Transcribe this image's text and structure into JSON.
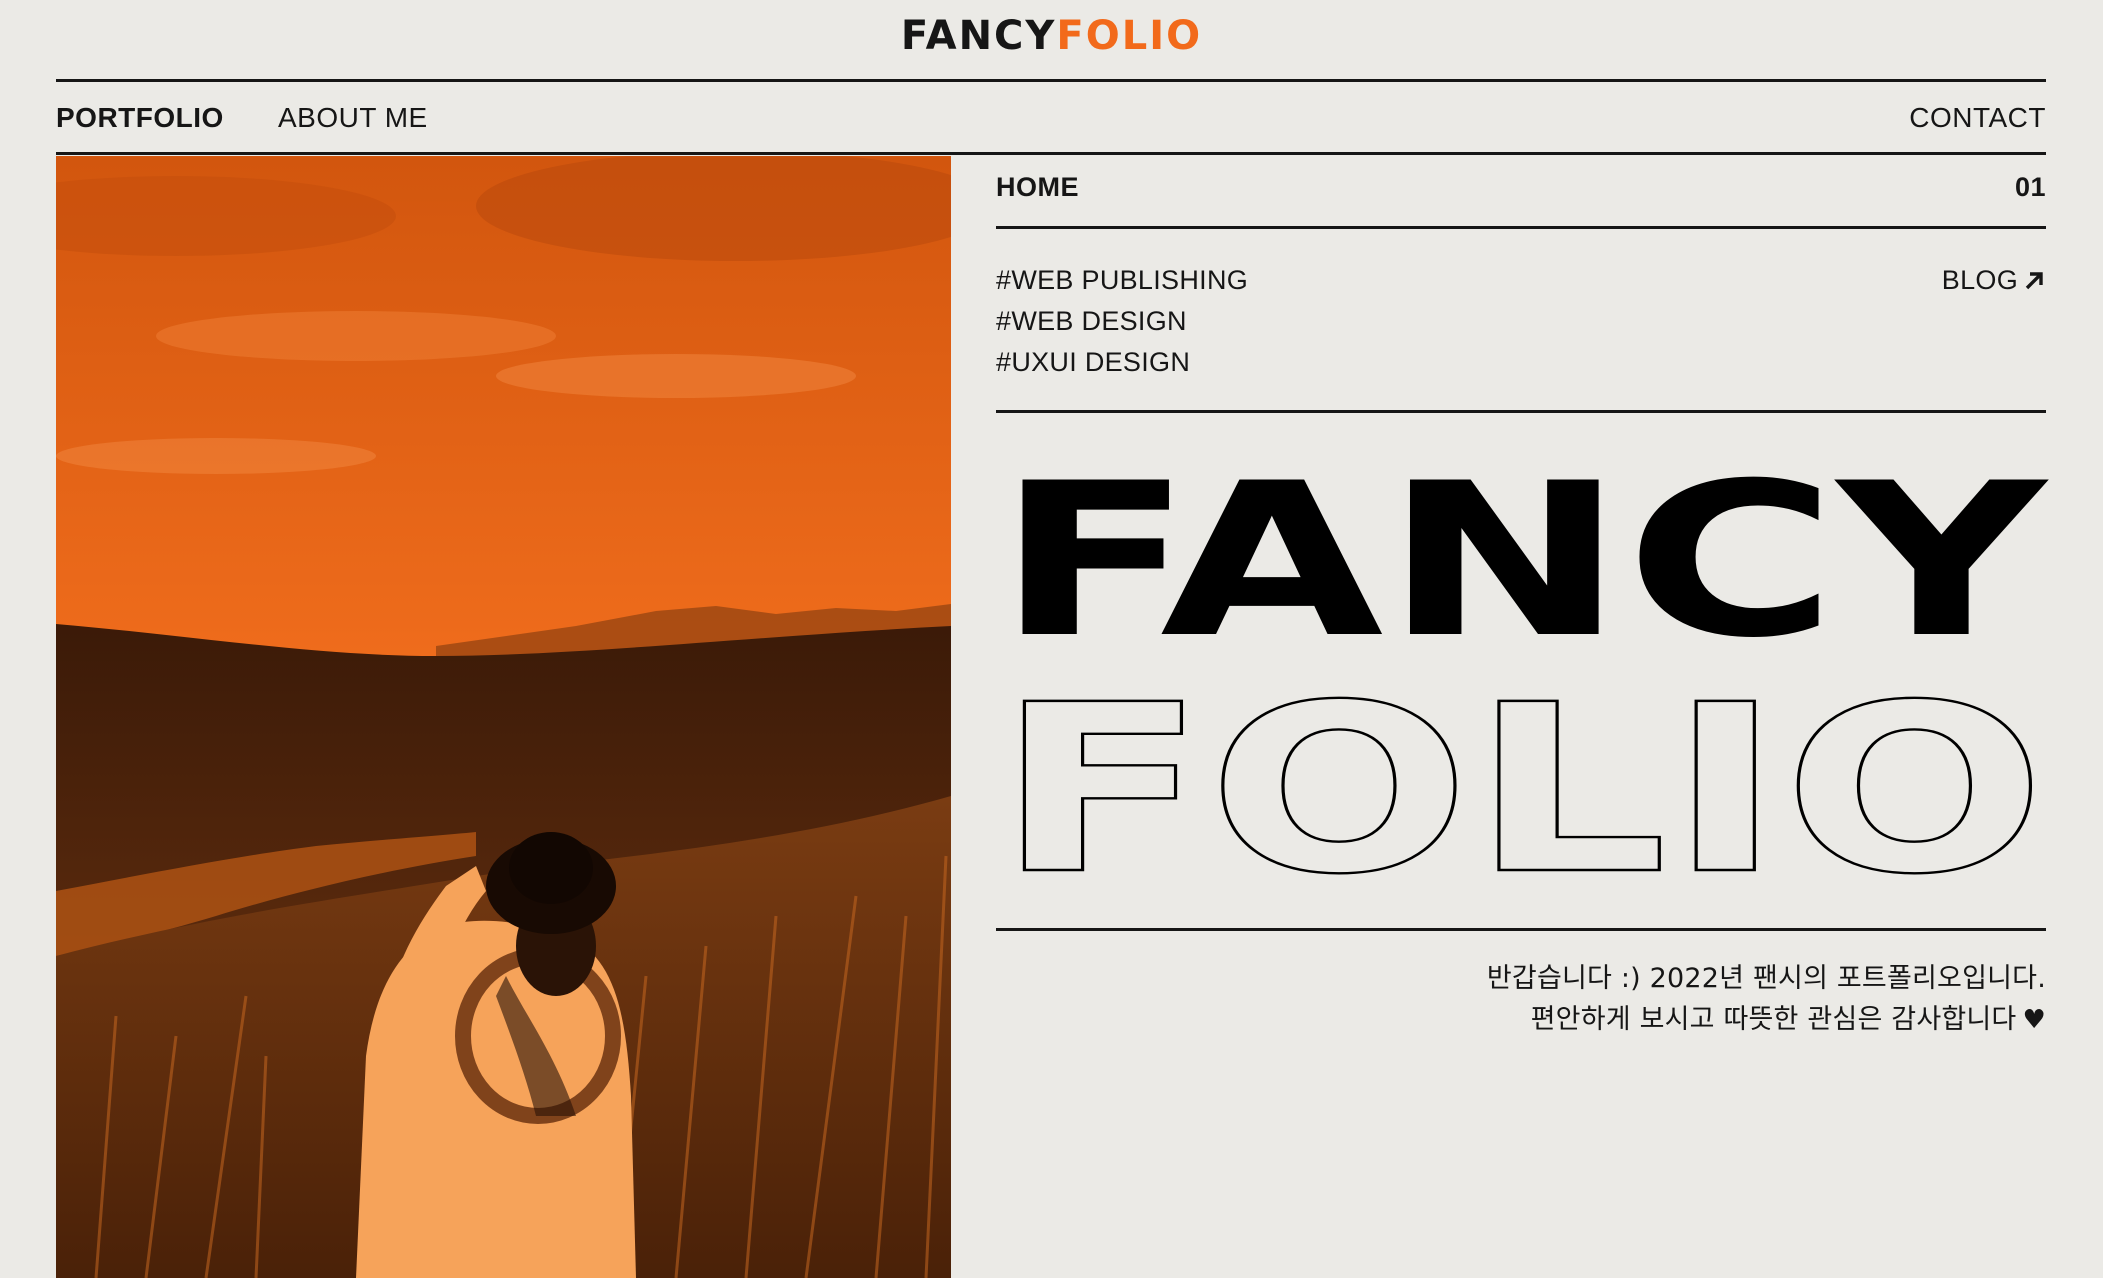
{
  "header": {
    "logo_part1": "FANCY",
    "logo_part2": "FOLIO"
  },
  "nav": {
    "portfolio": "PORTFOLIO",
    "about": "ABOUT ME",
    "contact": "CONTACT"
  },
  "section": {
    "label": "HOME",
    "number": "01"
  },
  "tags": [
    "#WEB PUBLISHING",
    "#WEB DESIGN",
    "#UXUI DESIGN"
  ],
  "blog": {
    "label": "BLOG",
    "icon": "arrow-up-right-icon"
  },
  "hero": {
    "title_line1": "FANCY",
    "title_line2": "FOLIO"
  },
  "greeting": {
    "line1": "반갑습니다 :) 2022년 팬시의 포트폴리오입니다.",
    "line2": "편안하게 보시고 따뜻한 관심은 감사합니다",
    "heart_icon": "heart-icon"
  },
  "colors": {
    "accent": "#f26a1b",
    "background": "#ebeae6",
    "text": "#161616"
  }
}
